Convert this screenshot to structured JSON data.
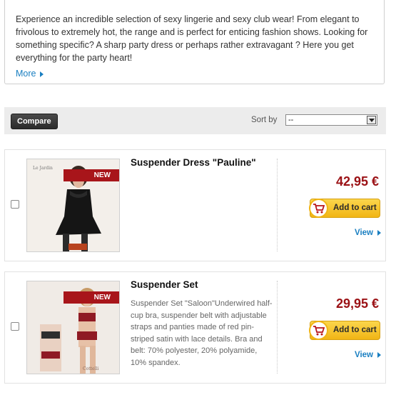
{
  "intro": {
    "text": "Experience an incredible selection of sexy lingerie and sexy club wear! From elegant to frivolous to extremely hot, the range and is perfect for enticing fashion shows. Looking for something specific? A sharp party dress or perhaps rather extravagant ? Here you get everything for the party heart!",
    "more_label": "More"
  },
  "toolbar": {
    "compare_label": "Compare",
    "sort_label": "Sort by",
    "sort_value": "--"
  },
  "products": [
    {
      "badge": "NEW",
      "title": "Suspender Dress \"Pauline\"",
      "description": "",
      "price": "42,95 €",
      "cart_label": "Add to cart",
      "view_label": "View"
    },
    {
      "badge": "NEW",
      "title": "Suspender Set",
      "description": "Suspender Set \"Saloon\"Underwired half-cup bra, suspender belt with adjustable straps and panties made of red pin-striped satin with lace details. Bra and belt: 70% polyester, 20% polyamide, 10% spandex.",
      "price": "29,95 €",
      "cart_label": "Add to cart",
      "view_label": "View"
    }
  ],
  "colors": {
    "price": "#9b1115",
    "link": "#1a7fc1",
    "cart_button": "#f1b515",
    "badge": "#a8151a"
  },
  "icons": [
    "arrow-right-icon",
    "dropdown-arrow-icon",
    "cart-icon",
    "chevron-right-icon"
  ]
}
